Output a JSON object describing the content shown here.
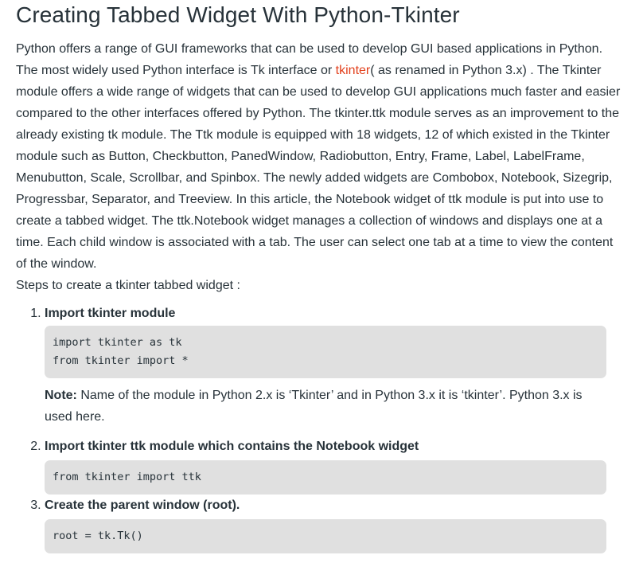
{
  "article": {
    "title": "Creating Tabbed Widget With Python-Tkinter",
    "intro_before_link": "Python offers a range of GUI frameworks that can be used to develop GUI based applications in Python. The most widely used Python interface is Tk interface or ",
    "intro_link": "tkinter",
    "intro_after_link": "( as renamed in Python 3.x) . The Tkinter module offers a wide range of widgets that can be used to develop GUI applications much faster and easier compared to the other interfaces offered by Python. The tkinter.ttk module serves as an improvement to the already existing tk module. The Ttk module is equipped with 18 widgets, 12 of which existed in the Tkinter module such as Button, Checkbutton, PanedWindow, Radiobutton, Entry, Frame, Label, LabelFrame, Menubutton, Scale, Scrollbar, and Spinbox. The newly added widgets are Combobox, Notebook, Sizegrip, Progressbar, Separator, and Treeview. In this article, the Notebook widget of ttk module is put into use to create a tabbed widget. The ttk.Notebook widget manages a collection of windows and displays one at a time. Each child window is associated with a tab. The user can select one tab at a time to view the content of the window.",
    "steps_intro": "Steps to create a tkinter tabbed widget :",
    "link_color": "#e2401c",
    "code_bg_color": "#e0e0e0"
  },
  "steps": [
    {
      "title": "Import tkinter module",
      "code": [
        "import tkinter as tk",
        "from tkinter import *"
      ],
      "note_label": "Note:",
      "note_text": " Name of the module in Python 2.x is ‘Tkinter’ and in Python 3.x it is ‘tkinter’. Python 3.x is used here."
    },
    {
      "title": "Import tkinter ttk module which contains the Notebook widget",
      "code": [
        "from tkinter import ttk"
      ]
    },
    {
      "title": "Create the parent window (root).",
      "code": [
        "root = tk.Tk()"
      ]
    }
  ]
}
